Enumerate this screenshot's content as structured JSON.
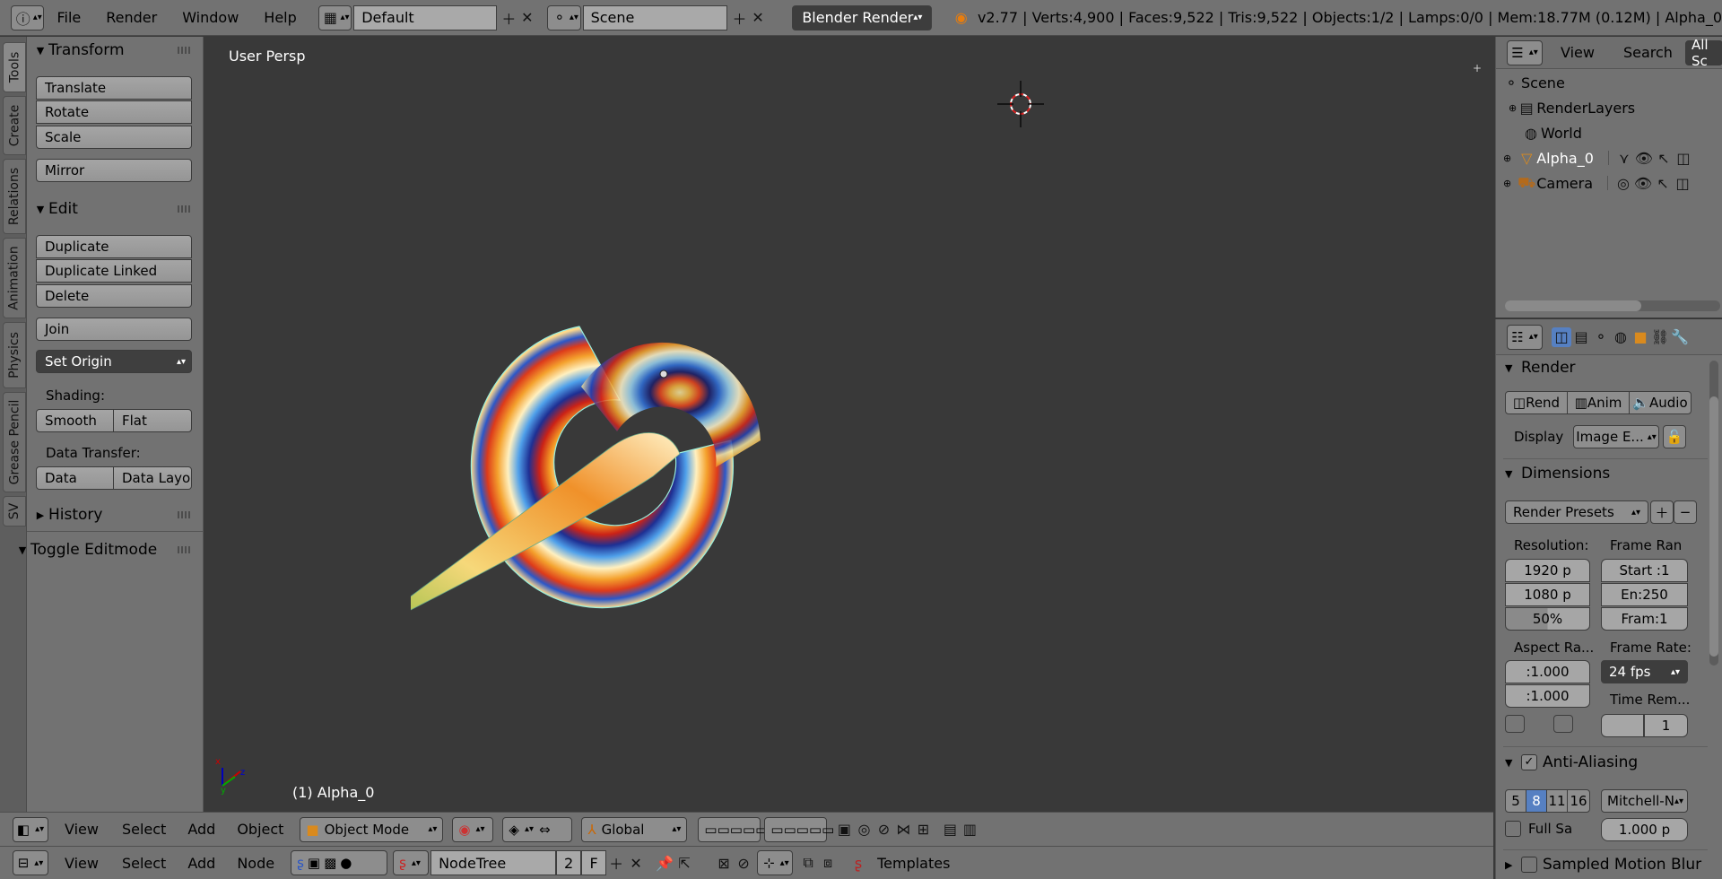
{
  "topbar": {
    "menus": [
      "File",
      "Render",
      "Window",
      "Help"
    ],
    "layout_name": "Default",
    "scene_name": "Scene",
    "engine": "Blender Render",
    "stats": "v2.77 | Verts:4,900 | Faces:9,522 | Tris:9,522 | Objects:1/2 | Lamps:0/0 | Mem:18.77M (0.12M) | Alpha_0"
  },
  "tabs": [
    "Tools",
    "Create",
    "Relations",
    "Animation",
    "Physics",
    "Grease Pencil",
    "SV"
  ],
  "toolpanel": {
    "transform_title": "Transform",
    "translate": "Translate",
    "rotate": "Rotate",
    "scale": "Scale",
    "mirror": "Mirror",
    "edit_title": "Edit",
    "duplicate": "Duplicate",
    "duplicate_linked": "Duplicate Linked",
    "delete": "Delete",
    "join": "Join",
    "set_origin": "Set Origin",
    "shading_label": "Shading:",
    "smooth": "Smooth",
    "flat": "Flat",
    "data_transfer_label": "Data Transfer:",
    "data": "Data",
    "data_layout": "Data Layo",
    "history_title": "History",
    "toggle_editmode": "Toggle Editmode"
  },
  "viewport": {
    "view_name": "User Persp",
    "object_label": "(1) Alpha_0"
  },
  "view3d_header": {
    "menus": [
      "View",
      "Select",
      "Add",
      "Object"
    ],
    "mode": "Object Mode",
    "orientation": "Global"
  },
  "node_header": {
    "menus": [
      "View",
      "Select",
      "Add",
      "Node"
    ],
    "nodetree": "NodeTree",
    "users": "2",
    "fake": "F",
    "templates": "Templates"
  },
  "outliner": {
    "view": "View",
    "search": "Search",
    "filter": "All Sc",
    "items": [
      "Scene",
      "RenderLayers",
      "World",
      "Alpha_0",
      "Camera"
    ]
  },
  "properties": {
    "render_title": "Render",
    "render_btn": "Rend",
    "anim_btn": "Anim",
    "audio_btn": "Audio",
    "display_label": "Display",
    "display_value": "Image E...",
    "dimensions_title": "Dimensions",
    "render_presets": "Render Presets",
    "resolution_label": "Resolution:",
    "frame_range_label": "Frame Ran",
    "res_x": "1920 p",
    "res_y": "1080 p",
    "res_pct": "50%",
    "start": "Start :1",
    "end": "En:250",
    "frame": "Fram:1",
    "aspect_label": "Aspect Ra...",
    "frame_rate_label": "Frame Rate:",
    "aspect_x": ":1.000",
    "aspect_y": ":1.000",
    "fps": "24 fps",
    "time_remap_label": "Time Rem...",
    "time_remap_old": "",
    "time_remap_new": "1",
    "aa_title": "Anti-Aliasing",
    "aa_samples": [
      "5",
      "8",
      "11",
      "16"
    ],
    "aa_filter": "Mitchell-N",
    "full_sample": "Full Sa",
    "filter_size": "1.000 p",
    "motion_blur_title": "Sampled Motion Blur"
  },
  "colors": {
    "accent_blue": "#5680c2",
    "panel_bg": "#727272",
    "viewport_bg": "#393939"
  }
}
